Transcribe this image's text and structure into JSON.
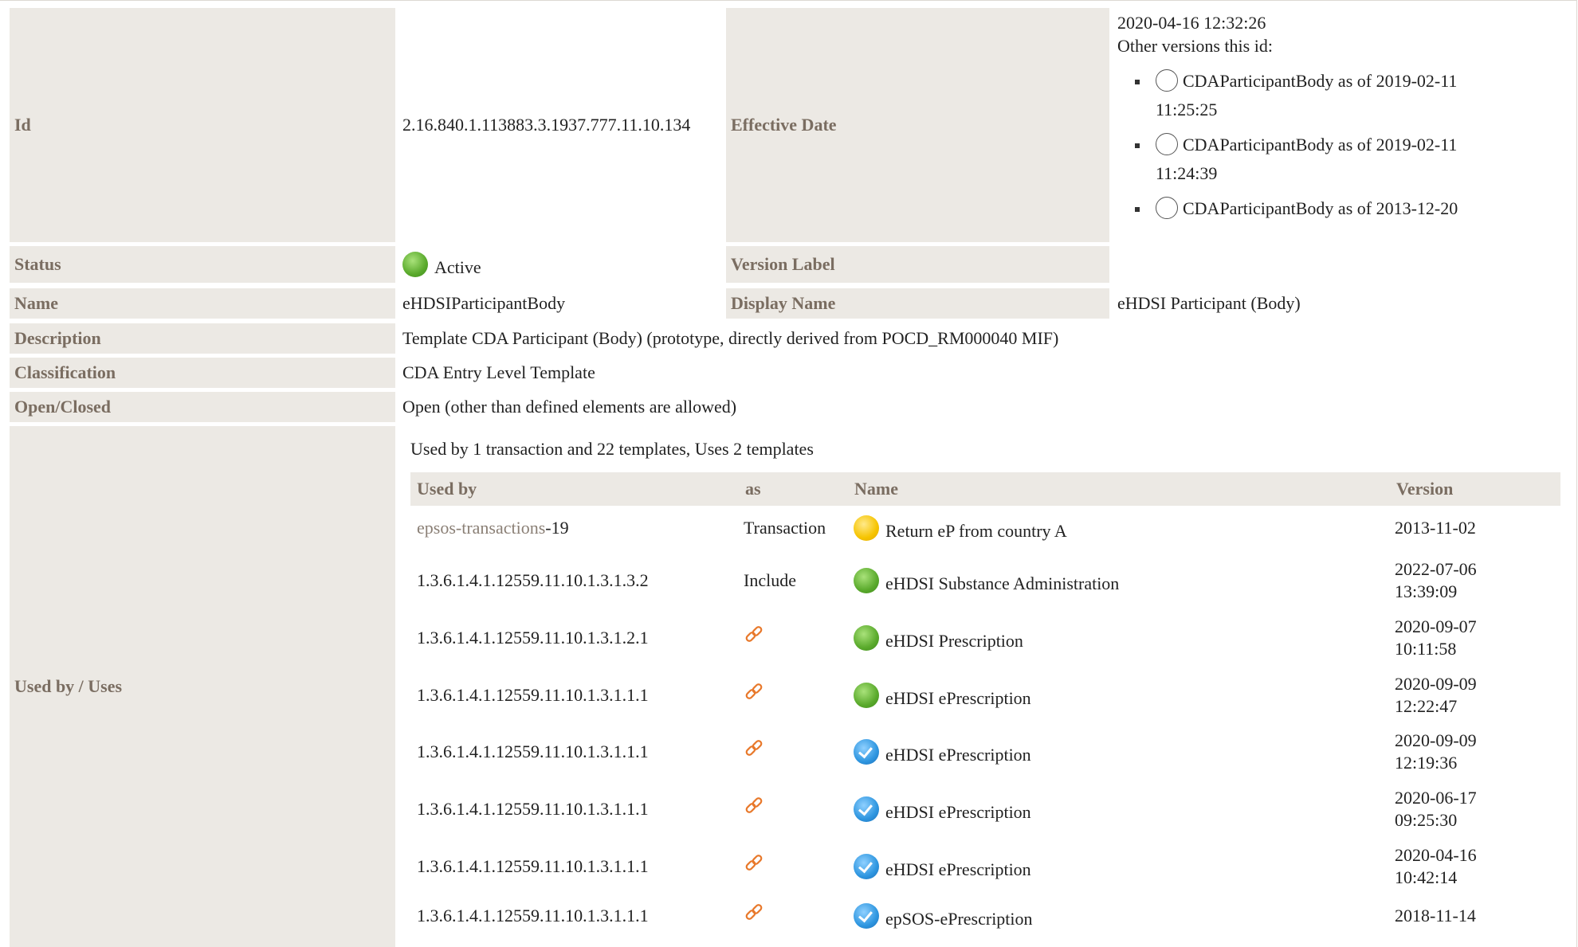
{
  "fields": {
    "id_label": "Id",
    "id_value": "2.16.840.1.113883.3.1937.777.11.10.134",
    "effective_date_label": "Effective Date",
    "effective_date_value": "2020-04-16 12:32:26",
    "other_versions_label": "Other versions this id:",
    "other_versions": [
      {
        "name": "CDAParticipantBody as of 2019-02-11",
        "time": "11:25:25"
      },
      {
        "name": "CDAParticipantBody as of 2019-02-11",
        "time": "11:24:39"
      },
      {
        "name": "CDAParticipantBody as of 2013-12-20",
        "time": ""
      }
    ],
    "status_label": "Status",
    "status_value": "Active",
    "version_label_label": "Version Label",
    "version_label_value": "",
    "name_label": "Name",
    "name_value": "eHDSIParticipantBody",
    "display_name_label": "Display Name",
    "display_name_value": "eHDSI Participant (Body)",
    "description_label": "Description",
    "description_value": "Template CDA Participant (Body) (prototype, directly derived from POCD_RM000040 MIF)",
    "classification_label": "Classification",
    "classification_value": "CDA Entry Level Template",
    "open_closed_label": "Open/Closed",
    "open_closed_value": "Open (other than defined elements are allowed)",
    "used_by_label": "Used by / Uses"
  },
  "usage": {
    "summary": "Used by 1 transaction and 22 templates, Uses 2 templates",
    "headers": {
      "used_by": "Used by",
      "as": "as",
      "name": "Name",
      "version": "Version"
    },
    "rows": [
      {
        "used_by_link": "epsos-transactions",
        "used_by_suffix": "-19",
        "as": "Transaction",
        "status": "yellow",
        "name": "Return eP from country A",
        "version_date": "2013-11-02",
        "version_time": ""
      },
      {
        "used_by_link": "",
        "used_by_suffix": "1.3.6.1.4.1.12559.11.10.1.3.1.3.2",
        "as": "Include",
        "status": "green",
        "name": "eHDSI Substance Administration",
        "version_date": "2022-07-06",
        "version_time": "13:39:09"
      },
      {
        "used_by_link": "",
        "used_by_suffix": "1.3.6.1.4.1.12559.11.10.1.3.1.2.1",
        "as": "",
        "status": "green",
        "name": "eHDSI Prescription",
        "version_date": "2020-09-07",
        "version_time": "10:11:58"
      },
      {
        "used_by_link": "",
        "used_by_suffix": "1.3.6.1.4.1.12559.11.10.1.3.1.1.1",
        "as": "",
        "status": "green",
        "name": "eHDSI ePrescription",
        "version_date": "2020-09-09",
        "version_time": "12:22:47"
      },
      {
        "used_by_link": "",
        "used_by_suffix": "1.3.6.1.4.1.12559.11.10.1.3.1.1.1",
        "as": "",
        "status": "blue",
        "name": "eHDSI ePrescription",
        "version_date": "2020-09-09",
        "version_time": "12:19:36"
      },
      {
        "used_by_link": "",
        "used_by_suffix": "1.3.6.1.4.1.12559.11.10.1.3.1.1.1",
        "as": "",
        "status": "blue",
        "name": "eHDSI ePrescription",
        "version_date": "2020-06-17",
        "version_time": "09:25:30"
      },
      {
        "used_by_link": "",
        "used_by_suffix": "1.3.6.1.4.1.12559.11.10.1.3.1.1.1",
        "as": "",
        "status": "blue",
        "name": "eHDSI ePrescription",
        "version_date": "2020-04-16",
        "version_time": "10:42:14"
      },
      {
        "used_by_link": "",
        "used_by_suffix": "1.3.6.1.4.1.12559.11.10.1.3.1.1.1",
        "as": "",
        "status": "blue",
        "name": "epSOS-ePrescription",
        "version_date": "2018-11-14",
        "version_time": ""
      }
    ]
  },
  "colors": {
    "label_bg": "#ece9e4",
    "label_text": "#7a6d61",
    "link_icon": "#e8782a",
    "status_active": "#5aaa2c",
    "status_draft": "#f6c400",
    "status_final": "#2e96e0"
  },
  "icons": {
    "status_active": "green-status-icon",
    "status_draft": "yellow-status-icon",
    "status_final": "blue-check-status-icon",
    "containment": "link-icon",
    "other_version": "empty-circle-icon"
  }
}
